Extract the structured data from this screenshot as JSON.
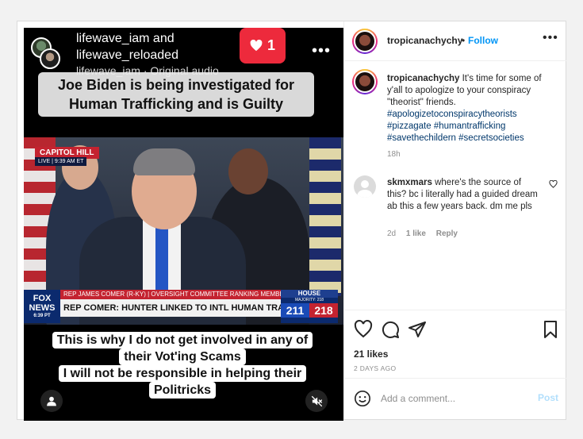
{
  "reel": {
    "user1": "lifewave_iam and",
    "user2": "lifewave_reloaded",
    "audio": "lifewave_iam · Original audio",
    "more": "•••",
    "like_count": "1",
    "caption_top": "Joe Biden is being investigated for Human Trafficking and is Guilty",
    "caption_bottom": [
      "This is why I do not get involved in any of",
      "their Vot'ing Scams",
      "I will not be responsible in helping their",
      "Politricks"
    ],
    "scene": {
      "location_tag": "CAPITOL HILL",
      "live_tag": "LIVE | 9:39 AM ET",
      "chyron_top": "REP JAMES COMER (R-KY) | OVERSIGHT COMMITTEE RANKING MEMBER",
      "chyron_main": "REP COMER: HUNTER LINKED TO INTL HUMAN TRAFFICKING",
      "network_line1": "FOX",
      "network_line2": "NEWS",
      "network_time": "6:39 PT",
      "house_title": "HOUSE",
      "house_majority": "MAJORITY: 218",
      "house_dem": "211",
      "house_rep": "218"
    }
  },
  "post": {
    "username": "tropicanachychy",
    "separator": "•",
    "follow_label": "Follow",
    "more": "•••",
    "caption_user": "tropicanachychy",
    "caption_text": "It's time for some of y'all to apologize to your conspiracy \"theorist\" friends.",
    "hashtags": [
      "#apologizetoconspiracytheorists",
      "#pizzagate",
      "#humantrafficking",
      "#savethechildern",
      "#secretsocieties"
    ],
    "caption_time": "18h",
    "reply": {
      "user": "skmxmars",
      "text": "where's the source of this? bc i literally had a guided dream ab this a few years back. dm me pls",
      "time": "2d",
      "likes": "1 like",
      "reply_label": "Reply"
    },
    "likes": "21 likes",
    "posted_ago": "2 DAYS AGO",
    "comment_placeholder": "Add a comment...",
    "post_label": "Post"
  },
  "colors": {
    "accent": "#0095f6",
    "like_badge": "#ed2a3c",
    "post_disabled": "#b2dffc"
  },
  "icons": [
    "heart-icon",
    "comment-icon",
    "share-icon",
    "bookmark-icon",
    "emoji-icon",
    "user-icon",
    "mute-icon",
    "more-icon"
  ]
}
